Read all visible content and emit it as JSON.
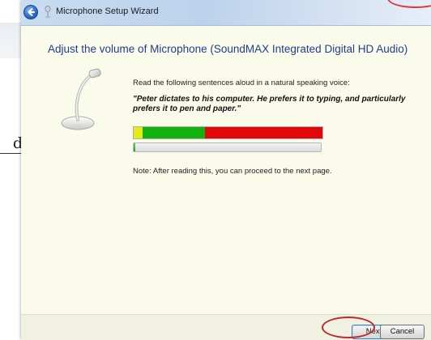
{
  "window": {
    "title": "Microphone Setup Wizard",
    "back_icon": "back-arrow-icon",
    "app_icon": "microphone-icon"
  },
  "page": {
    "heading": "Adjust the volume of Microphone (SoundMAX Integrated Digital HD Audio)",
    "instruction": "Read the following sentences aloud in a natural speaking voice:",
    "quote": "\"Peter dictates to his computer. He prefers it to typing, and particularly prefers it to pen and paper.\"",
    "note": "Note: After reading this, you can proceed to the next page.",
    "illustration_icon": "desk-microphone-icon"
  },
  "meter": {
    "zones": [
      {
        "name": "low",
        "color": "#e5ec15"
      },
      {
        "name": "ok",
        "color": "#12b30e"
      },
      {
        "name": "loud",
        "color": "#e1070b"
      }
    ],
    "progress_fraction": 0.01
  },
  "buttons": {
    "next_label": "Next",
    "cancel_label": "Cancel"
  },
  "background_doc": {
    "text_fragment": "d"
  },
  "colors": {
    "heading": "#1e3d8f",
    "annotation": "#c1272d",
    "dialog_bg": "#fbfbec"
  }
}
